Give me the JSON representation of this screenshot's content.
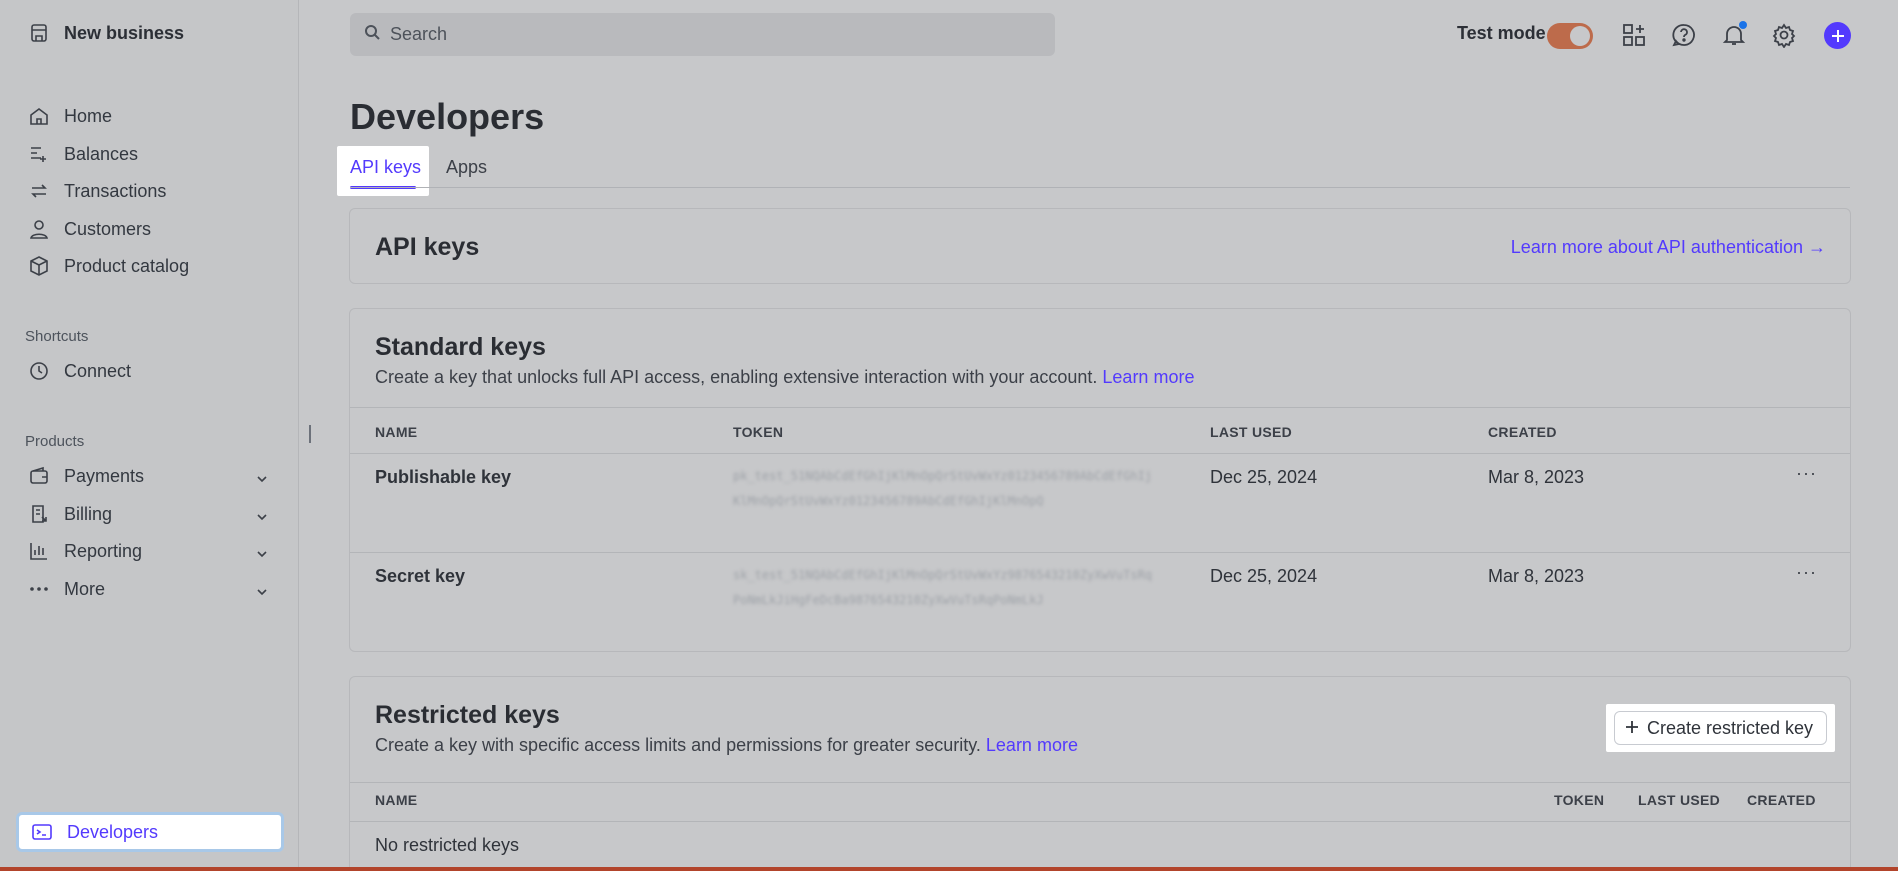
{
  "sidebar": {
    "brand": "New business",
    "nav": [
      {
        "label": "Home",
        "icon": "home-icon"
      },
      {
        "label": "Balances",
        "icon": "balances-icon"
      },
      {
        "label": "Transactions",
        "icon": "transactions-icon"
      },
      {
        "label": "Customers",
        "icon": "customer-icon"
      },
      {
        "label": "Product catalog",
        "icon": "box-icon"
      }
    ],
    "shortcuts_label": "Shortcuts",
    "shortcuts": [
      {
        "label": "Connect",
        "icon": "clock-icon"
      }
    ],
    "products_label": "Products",
    "products": [
      {
        "label": "Payments",
        "icon": "wallet-icon"
      },
      {
        "label": "Billing",
        "icon": "billing-icon"
      },
      {
        "label": "Reporting",
        "icon": "chart-icon"
      },
      {
        "label": "More",
        "icon": "more-icon"
      }
    ],
    "developers_label": "Developers"
  },
  "topbar": {
    "search_placeholder": "Search",
    "test_mode_label": "Test mode",
    "test_mode_on": true
  },
  "page": {
    "title": "Developers",
    "tabs": [
      "API keys",
      "Apps"
    ],
    "active_tab": "API keys"
  },
  "api_keys_card": {
    "title": "API keys",
    "learn_link": "Learn more about API authentication →"
  },
  "standard_keys": {
    "title": "Standard keys",
    "description": "Create a key that unlocks full API access, enabling extensive interaction with your account.",
    "learn_more": "Learn more",
    "columns": [
      "NAME",
      "TOKEN",
      "LAST USED",
      "CREATED"
    ],
    "rows": [
      {
        "name": "Publishable key",
        "token": "pk_test_51NQAbCdEfGhIjKlMnOpQrStUvWxYz0123456789AbCdEfGhIjKlMnOpQrStUvWxYz0123456789AbCdEfGhIjKlMnOpQ",
        "last_used": "Dec 25, 2024",
        "created": "Mar 8, 2023",
        "menu": "···"
      },
      {
        "name": "Secret key",
        "token": "sk_test_51NQAbCdEfGhIjKlMnOpQrStUvWxYz9876543210ZyXwVuTsRqPoNmLkJiHgFeDcBa9876543210ZyXwVuTsRqPoNmLkJ",
        "last_used": "Dec 25, 2024",
        "created": "Mar 8, 2023",
        "menu": "···"
      }
    ]
  },
  "restricted_keys": {
    "title": "Restricted keys",
    "description": "Create a key with specific access limits and permissions for greater security.",
    "learn_more": "Learn more",
    "create_button": "Create restricted key",
    "columns": [
      "NAME",
      "TOKEN",
      "LAST USED",
      "CREATED"
    ],
    "empty": "No restricted keys"
  },
  "colors": {
    "accent": "#533afd",
    "toggle": "#bd6b4b",
    "background": "#c7c8ca"
  }
}
